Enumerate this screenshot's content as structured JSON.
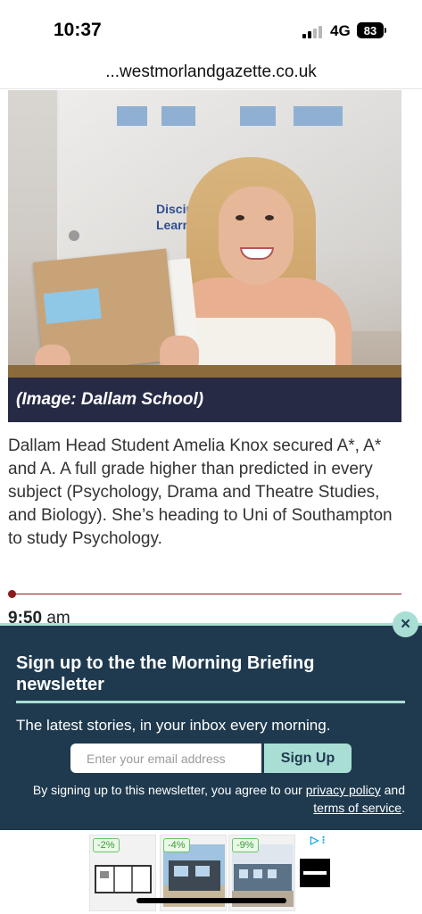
{
  "status_bar": {
    "time": "10:37",
    "network": "4G",
    "battery": "83"
  },
  "browser": {
    "url": "...westmorlandgazette.co.uk"
  },
  "article": {
    "photo_sign_line1": "Disciplina, P",
    "photo_sign_line2": "Learning for a",
    "image_caption": "(Image: Dallam School)",
    "body": "Dallam Head Student Amelia Knox secured A*, A* and A. A full grade higher than predicted in every subject (Psychology, Drama and Theatre Studies, and Biology). She’s heading to Uni of Southampton to study Psychology.",
    "next_time": "9:50",
    "next_time_suffix": "am"
  },
  "newsletter": {
    "title": "Sign up to the the Morning Briefing newsletter",
    "subtitle": "The latest stories, in your inbox every morning.",
    "email_placeholder": "Enter your email address",
    "signup_label": "Sign Up",
    "terms_prefix": "By signing up to this newsletter, you agree to our",
    "privacy_link": "privacy policy",
    "terms_and": "and",
    "terms_link": "terms of service",
    "terms_suffix": ".",
    "close_label": "×"
  },
  "ad": {
    "discount_1": "-2%",
    "discount_2": "-4%",
    "discount_3": "-9%",
    "adchoices_label": "▷ ⁝"
  },
  "colors": {
    "caption_bg": "#262a45",
    "newsletter_bg": "#1f3a4f",
    "accent_mint": "#a9ded5",
    "timeline_red": "#8c1b1b"
  }
}
